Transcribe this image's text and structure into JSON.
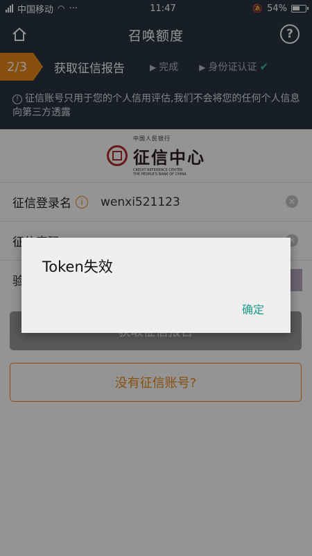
{
  "status_bar": {
    "carrier": "中国移动",
    "time": "11:47",
    "battery": "54%",
    "more": "···"
  },
  "header": {
    "title": "召唤额度"
  },
  "steps": {
    "current": "2/3",
    "step1": "获取征信报告",
    "step2": "完成",
    "step3": "身份证认证"
  },
  "notice": {
    "text": "征信账号只用于您的个人信用评估,我们不会将您的任何个人信息向第三方透露"
  },
  "logo": {
    "top": "中国人民银行",
    "main": "征信中心",
    "en_line1": "CREDIT REFERENCE CENTER",
    "en_line2": "THE PEOPLE'S BANK OF CHINA"
  },
  "form": {
    "login_label": "征信登录名",
    "login_value": "wenxi521123",
    "password_label": "征信密码",
    "code_label": "验证码"
  },
  "buttons": {
    "get_report": "获取征信报告",
    "no_account": "没有征信账号?"
  },
  "dialog": {
    "title": "Token失效",
    "confirm": "确定"
  }
}
